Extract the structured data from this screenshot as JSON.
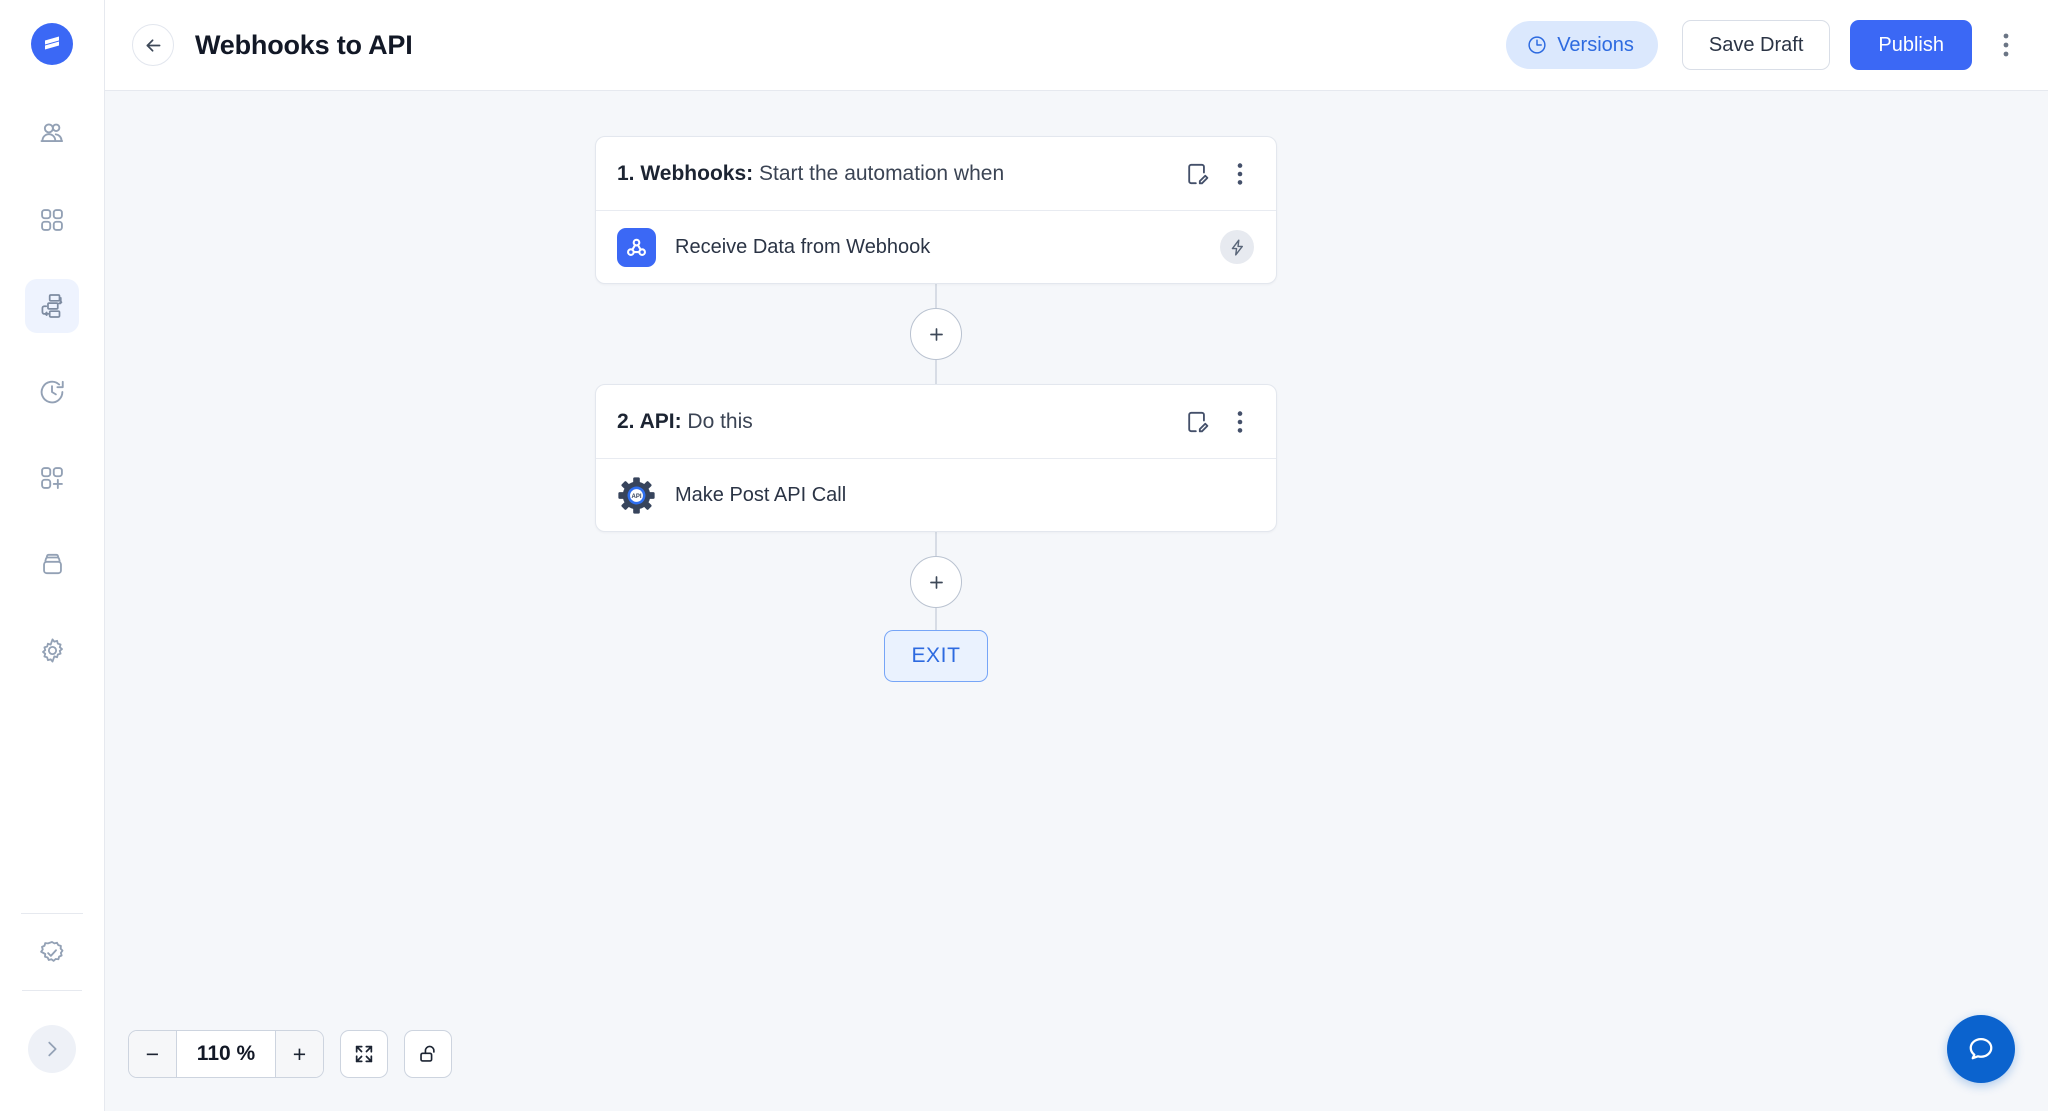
{
  "brand": {
    "logo_icon": "stacked-lines-logo-icon",
    "accent_color": "#3b68f5",
    "canvas_color": "#f5f7fa"
  },
  "sidebar": {
    "items": [
      {
        "icon": "users-icon",
        "name": "sidebar-item-users",
        "active": false
      },
      {
        "icon": "grid-apps-icon",
        "name": "sidebar-item-apps",
        "active": false
      },
      {
        "icon": "automation-flow-icon",
        "name": "sidebar-item-automations",
        "active": true
      },
      {
        "icon": "history-clock-icon",
        "name": "sidebar-item-history",
        "active": false
      },
      {
        "icon": "grid-plus-icon",
        "name": "sidebar-item-add-app",
        "active": false
      },
      {
        "icon": "archive-box-icon",
        "name": "sidebar-item-storage",
        "active": false
      },
      {
        "icon": "gear-icon",
        "name": "sidebar-item-settings",
        "active": false
      }
    ],
    "bottom": {
      "badge_icon": "verified-check-icon",
      "expand_icon": "chevron-right-icon"
    }
  },
  "header": {
    "back_icon": "arrow-left-icon",
    "title": "Webhooks to API",
    "versions_label": "Versions",
    "versions_icon": "clock-icon",
    "save_label": "Save Draft",
    "publish_label": "Publish",
    "kebab_icon": "kebab-menu-icon"
  },
  "flow": {
    "nodes": [
      {
        "title_prefix": "1. Webhooks:",
        "title_suffix": "Start the automation when",
        "edit_icon": "edit-document-icon",
        "kebab_icon": "kebab-menu-icon",
        "app_icon": "webhook-icon",
        "action_label": "Receive Data from Webhook",
        "badge_icon": "lightning-bolt-icon"
      },
      {
        "title_prefix": "2. API:",
        "title_suffix": "Do this",
        "edit_icon": "edit-document-icon",
        "kebab_icon": "kebab-menu-icon",
        "app_icon": "api-gear-icon",
        "action_label": "Make Post API Call",
        "badge_icon": ""
      }
    ],
    "add_step_icon": "plus-icon",
    "exit_label": "EXIT"
  },
  "zoom_toolbar": {
    "minus_label": "−",
    "value": "110 %",
    "plus_label": "+",
    "fit_icon": "fit-screen-icon",
    "lock_icon": "unlock-icon"
  },
  "chat": {
    "icon": "chat-bubble-icon"
  }
}
